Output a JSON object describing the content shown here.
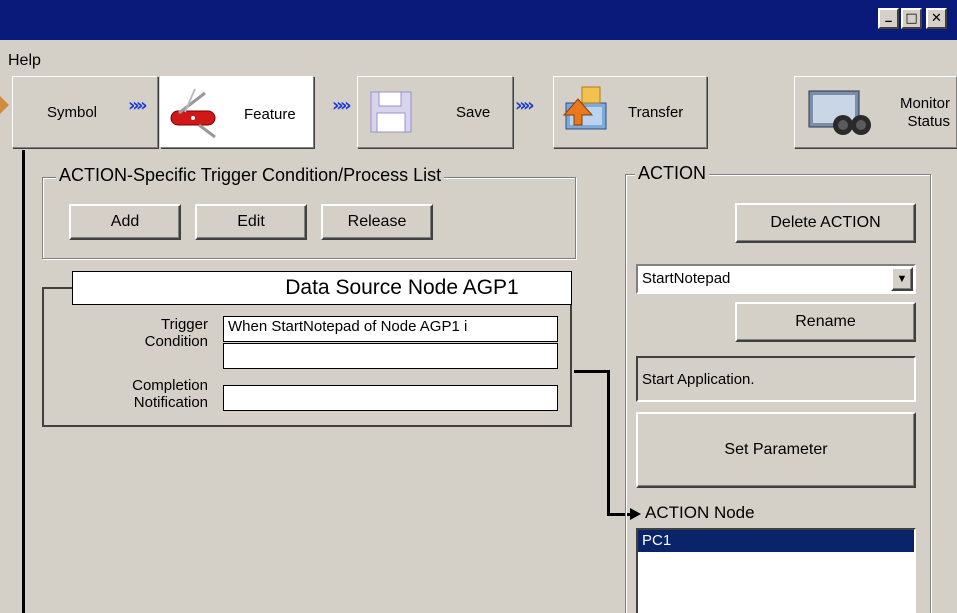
{
  "window": {
    "caption_buttons": [
      {
        "name": "minimize-button",
        "glyph": "_"
      },
      {
        "name": "maximize-button",
        "glyph": "□"
      },
      {
        "name": "close-button",
        "glyph": "✕"
      }
    ]
  },
  "menu": {
    "help": "Help"
  },
  "steps": {
    "symbol": "Symbol",
    "feature": "Feature",
    "save": "Save",
    "transfer": "Transfer",
    "monitor_line1": "Monitor",
    "monitor_line2": "Status",
    "chevron": "»"
  },
  "trigger_list": {
    "title": "ACTION-Specific Trigger Condition/Process List",
    "add": "Add",
    "edit": "Edit",
    "release": "Release"
  },
  "node": {
    "title": "Data Source Node AGP1",
    "trigger_label_1": "Trigger",
    "trigger_label_2": "Condition",
    "trigger_value": "When StartNotepad of Node AGP1 i",
    "trigger_value_2": "",
    "completion_label_1": "Completion",
    "completion_label_2": "Notification",
    "completion_value": ""
  },
  "action": {
    "title": "ACTION",
    "delete": "Delete ACTION",
    "selected": "StartNotepad",
    "rename": "Rename",
    "description": "Start Application.",
    "set_parameter": "Set Parameter",
    "node_label": "ACTION Node",
    "nodes": [
      "PC1"
    ]
  },
  "colors": {
    "titlebar": "#0a1a7a",
    "selection": "#0a246a",
    "chevron": "#1a3bd6",
    "face": "#d4d0c8"
  }
}
